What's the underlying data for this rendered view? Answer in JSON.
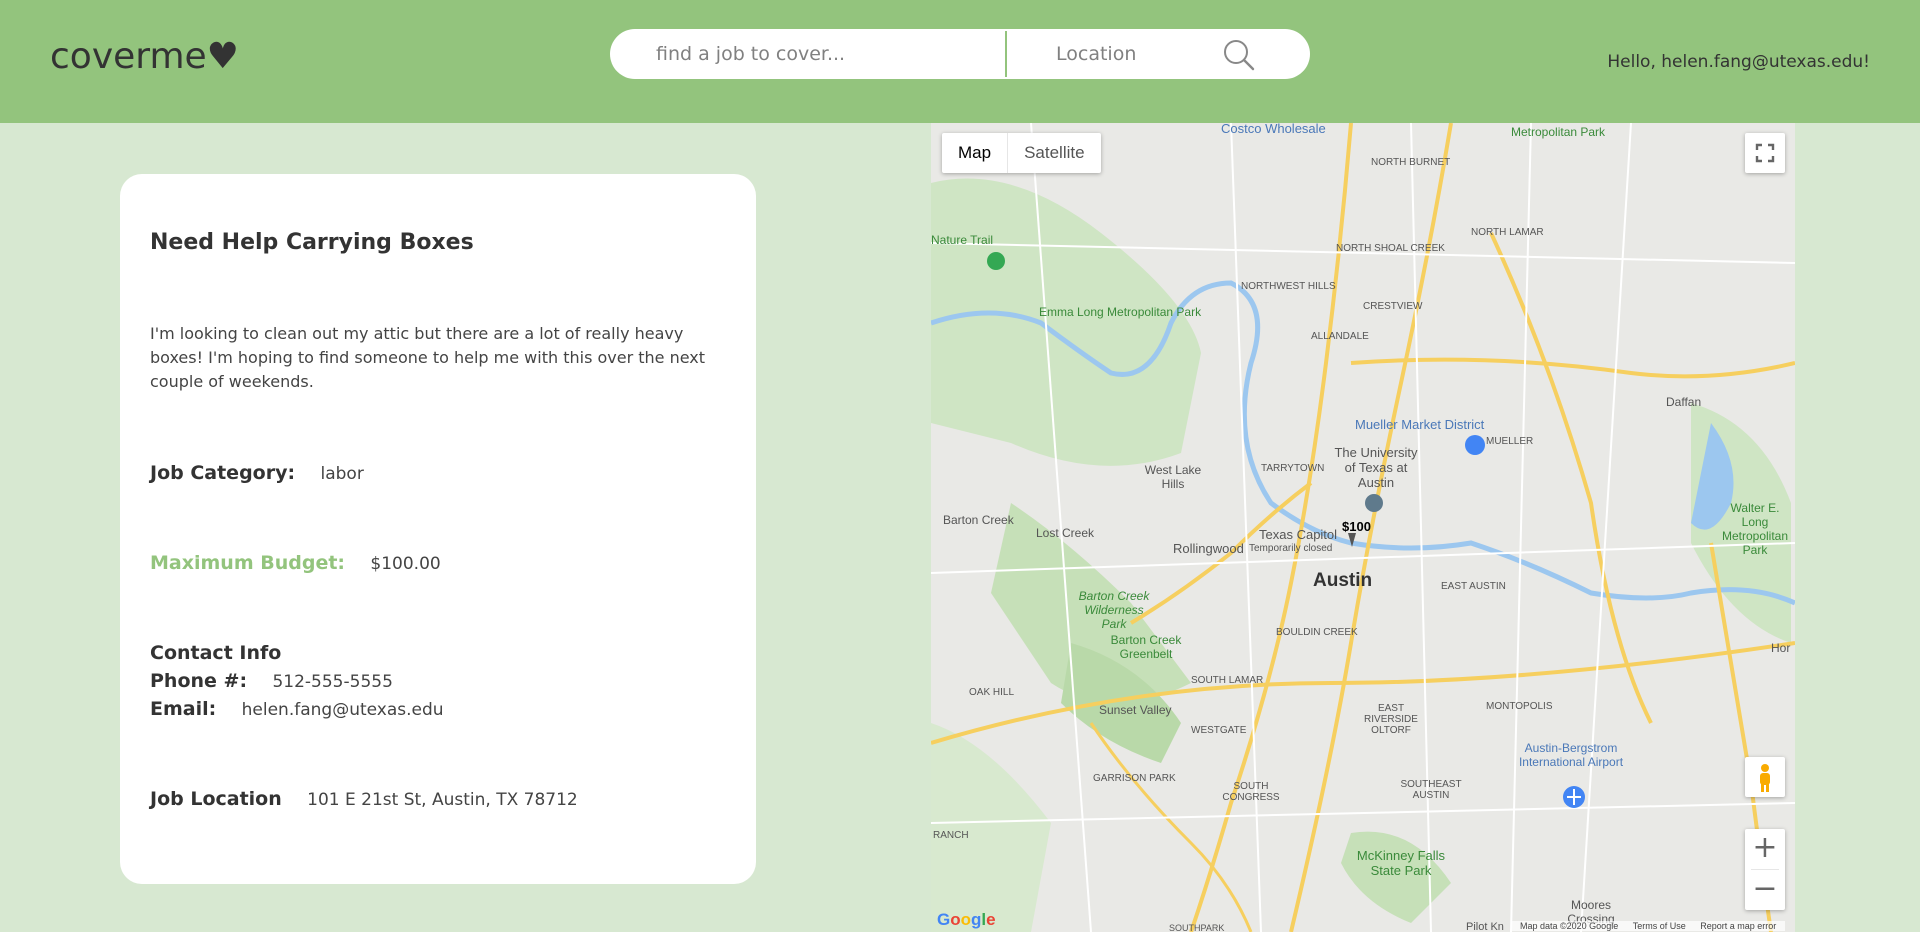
{
  "header": {
    "logo": "coverme♥",
    "search_job_placeholder": "find a job to cover...",
    "search_location_placeholder": "Location",
    "greeting": "Hello, helen.fang@utexas.edu!"
  },
  "job": {
    "title": "Need Help Carrying Boxes",
    "description": "I'm looking to clean out my attic but there are a lot of really heavy boxes! I'm hoping to find someone to help me with this over the next couple of weekends.",
    "category_label": "Job Category:",
    "category": "labor",
    "budget_label": "Maximum Budget:",
    "budget": "$100.00",
    "contact_heading": "Contact Info",
    "phone_label": "Phone #:",
    "phone": "512-555-5555",
    "email_label": "Email:",
    "email": "helen.fang@utexas.edu",
    "location_label": "Job Location",
    "location": "101 E 21st St, Austin, TX 78712"
  },
  "map": {
    "type_map": "Map",
    "type_satellite": "Satellite",
    "price_marker": "$100",
    "city_label": "Austin",
    "zoom_in": "+",
    "zoom_out": "−",
    "google": "Google",
    "attribution": "Map data ©2020 Google",
    "terms": "Terms of Use",
    "report": "Report a map error",
    "labels": [
      "Costco Wholesale",
      "Metropolitan Park",
      "NORTH BURNET",
      "NORTH LAMAR",
      "NORTH SHOAL CREEK",
      "Nature Trail",
      "Emma Long Metropolitan Park",
      "NORTHWEST HILLS",
      "CRESTVIEW",
      "ALLANDALE",
      "Mueller Market District",
      "The University of Texas at Austin",
      "MUELLER",
      "Daffan",
      "West Lake Hills",
      "TARRYTOWN",
      "Barton Creek",
      "Lost Creek",
      "Rollingwood",
      "Texas Capitol",
      "Temporarily closed",
      "EAST AUSTIN",
      "Walter E. Long Metropolitan Park",
      "Barton Creek Wilderness Park",
      "Barton Creek Greenbelt",
      "BOULDIN CREEK",
      "SOUTH LAMAR",
      "OAK HILL",
      "Sunset Valley",
      "WESTGATE",
      "EAST RIVERSIDE OLTORF",
      "MONTOPOLIS",
      "Austin-Bergstrom International Airport",
      "GARRISON PARK",
      "SOUTH CONGRESS",
      "SOUTHEAST AUSTIN",
      "McKinney Falls State Park",
      "Moores Crossing",
      "RANCH",
      "Hor",
      "Pilot Kn",
      "SOUTHPARK"
    ]
  },
  "colors": {
    "header_bg": "#93c47d",
    "page_bg": "#d7e8d1",
    "accent": "#93c47d"
  }
}
